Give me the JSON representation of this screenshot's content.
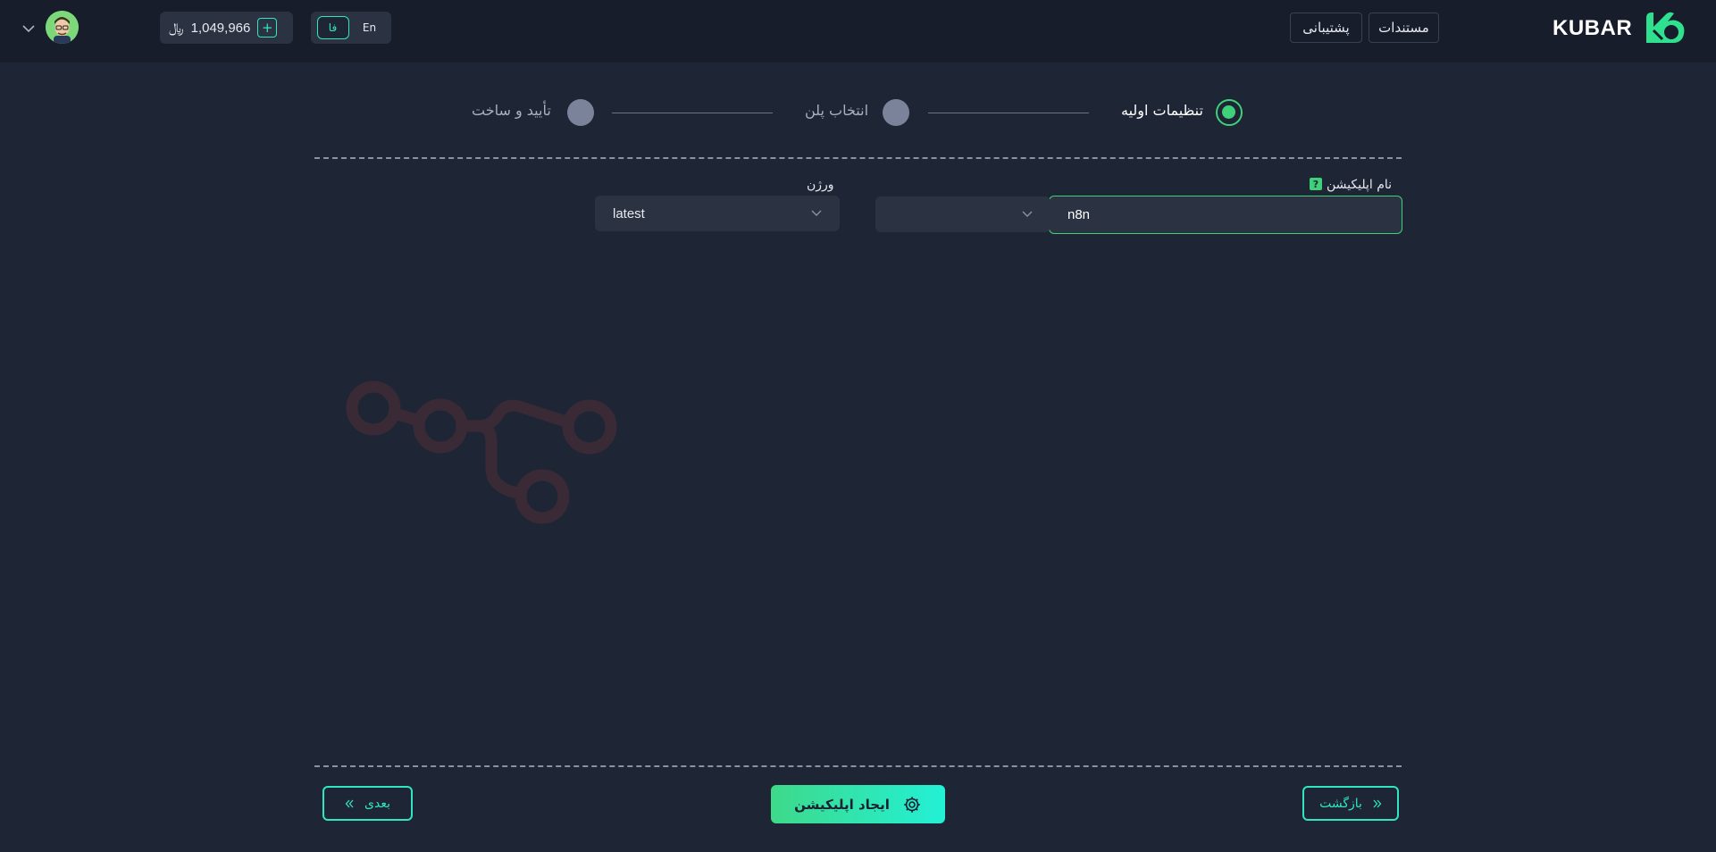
{
  "header": {
    "brand": "KUBAR",
    "nav": {
      "docs_label": "مستندات",
      "support_label": "پشتیبانی"
    },
    "lang": {
      "en_label": "En",
      "fa_label": "فا"
    },
    "balance": {
      "amount": "1,049,966",
      "currency": "﷼"
    },
    "icons": {
      "menu": "chevron-down-icon",
      "avatar": "user-avatar",
      "add": "plus-icon",
      "logo": "kubar-cloud-logo"
    }
  },
  "stepper": {
    "steps": [
      {
        "label": "تنظیمات اولیه",
        "state": "active"
      },
      {
        "label": "انتخاب پلن",
        "state": "pending"
      },
      {
        "label": "تأیید و ساخت",
        "state": "pending"
      }
    ]
  },
  "form": {
    "name_label": "نام اپلیکیشن",
    "name_value": "n8n",
    "help_icon_text": "?",
    "image_select_value": "",
    "version_label": "ورژن",
    "version_value": "latest"
  },
  "footer": {
    "back_label": "بازگشت",
    "create_label": "ایجاد اپلیکیشن",
    "next_label": "بعدی"
  },
  "colors": {
    "accent": "#2ee6c0",
    "green": "#3fd07a",
    "bg": "#1e2535",
    "header_bg": "#171d2a",
    "input_bg": "#2b3342",
    "pending_step": "#7a8399",
    "watermark": "#3a2a36"
  }
}
